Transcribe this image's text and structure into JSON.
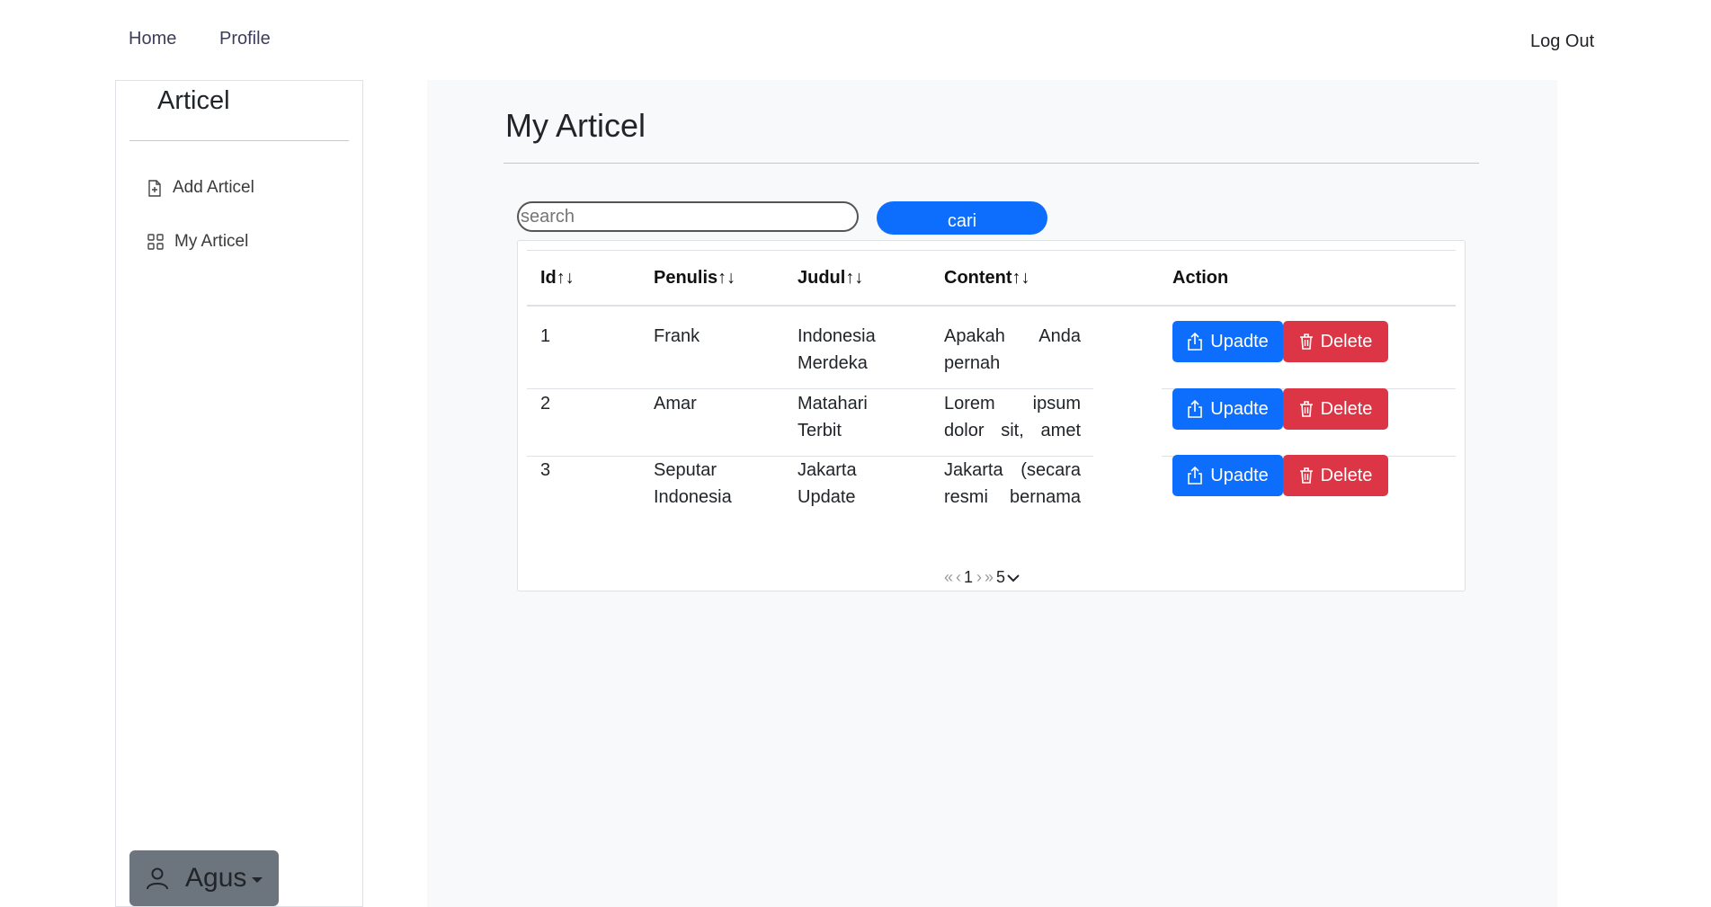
{
  "nav": {
    "home": "Home",
    "profile": "Profile",
    "logout": "Log Out"
  },
  "sidebar": {
    "brand": "Articel",
    "items": [
      {
        "label": "Add Articel",
        "icon": "file-plus-icon"
      },
      {
        "label": "My Articel",
        "icon": "grid-icon"
      }
    ],
    "user": {
      "name": "Agus",
      "icon": "person-icon"
    }
  },
  "main": {
    "title": "My Articel",
    "search": {
      "placeholder": "search",
      "value": ""
    },
    "search_button": "cari",
    "table": {
      "headers": [
        "Id↑↓",
        "Penulis↑↓",
        "Judul↑↓",
        "Content↑↓",
        "Action"
      ],
      "rows": [
        {
          "id": "1",
          "penulis": "Frank",
          "judul": "Indonesia Merdeka",
          "content": "Apakah Anda pernah mendengar …"
        },
        {
          "id": "2",
          "penulis": "Amar",
          "judul": "Matahari Terbit",
          "content": "Lorem ipsum dolor sit, amet consectetur …"
        },
        {
          "id": "3",
          "penulis": "Seputar Indonesia",
          "judul": "Jakarta Update",
          "content": "Jakarta (secara resmi bernama Daerah Khusus …"
        }
      ],
      "update_label": "Upadte",
      "delete_label": "Delete"
    },
    "pagination": {
      "first": "«",
      "prev": "‹",
      "page": "1",
      "next": "›",
      "last": "»",
      "page_size": "5"
    }
  },
  "colors": {
    "primary": "#0d6efd",
    "danger": "#dc3545",
    "secondary": "#6c757d",
    "main_bg": "#f8f9fa"
  }
}
